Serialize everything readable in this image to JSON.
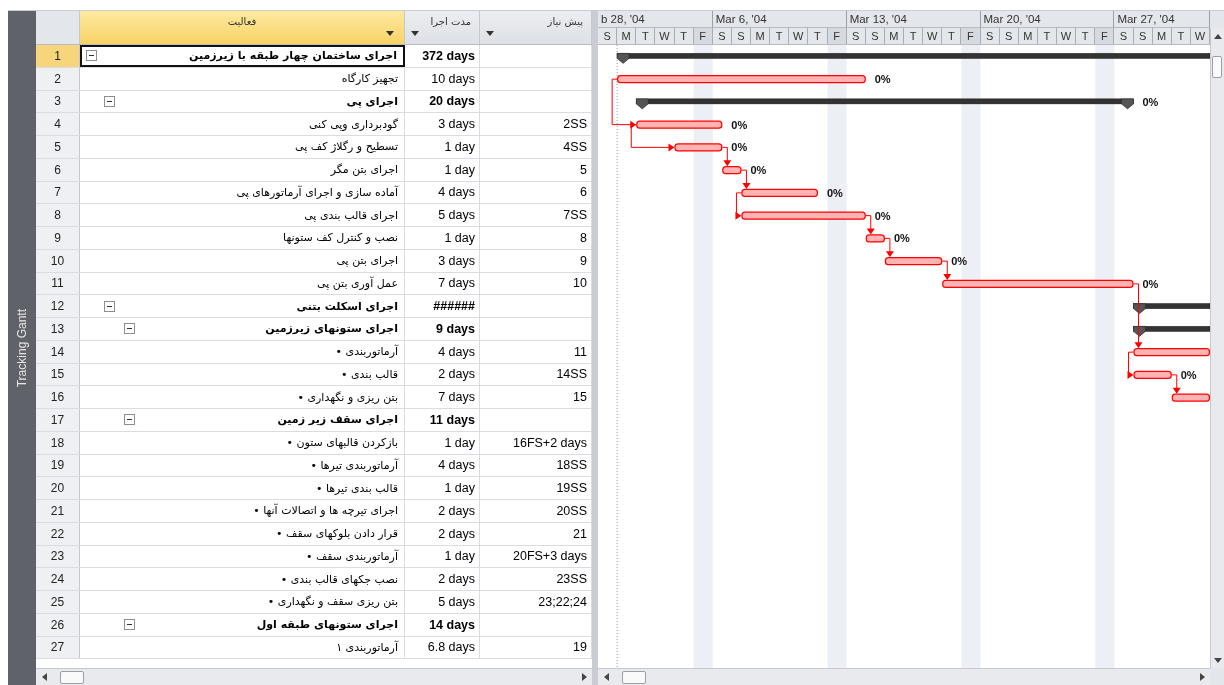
{
  "view_bar": {
    "label": "Tracking Gantt"
  },
  "table": {
    "columns": [
      {
        "label": "پیش نیاز",
        "selected": false
      },
      {
        "label": "مدت اجرا",
        "selected": false
      },
      {
        "label": "فعالیت",
        "selected": true
      }
    ],
    "rows": [
      {
        "id": "1",
        "kind": "summary",
        "expanded": true,
        "selected": true,
        "name": "اجرای ساختمان چهار طبقه با زیرزمین",
        "duration": "372 days",
        "children": [
          {
            "id": "2",
            "kind": "task",
            "selected": false,
            "name": "تجهیز کارگاه",
            "duration": "10 days"
          },
          {
            "id": "3",
            "kind": "summary",
            "expanded": true,
            "selected": false,
            "name": "اجرای پی",
            "duration": "20 days",
            "children": [
              {
                "id": "4",
                "kind": "task",
                "selected": false,
                "name": "گودبرداری وپی کنی",
                "duration": "3 days",
                "predecessors": "2SS"
              },
              {
                "id": "5",
                "kind": "task",
                "selected": false,
                "name": "تسطیح و رگلاژ کف پی",
                "duration": "1 day",
                "predecessors": "4SS"
              },
              {
                "id": "6",
                "kind": "task",
                "selected": false,
                "name": "اجرای بتن مگر",
                "duration": "1 day",
                "predecessors": "5"
              },
              {
                "id": "7",
                "kind": "task",
                "selected": false,
                "name": "آماده سازی و اجرای آرماتورهای پی",
                "duration": "4 days",
                "predecessors": "6"
              },
              {
                "id": "8",
                "kind": "task",
                "selected": false,
                "name": "اجرای قالب بندی پی",
                "duration": "5 days",
                "predecessors": "7SS"
              },
              {
                "id": "9",
                "kind": "task",
                "selected": false,
                "name": "نصب و کنترل کف ستونها",
                "duration": "1 day",
                "predecessors": "8"
              },
              {
                "id": "10",
                "kind": "task",
                "selected": false,
                "name": "اجرای بتن پی",
                "duration": "3 days",
                "predecessors": "9"
              },
              {
                "id": "11",
                "kind": "task",
                "selected": false,
                "name": "عمل آوری بتن پی",
                "duration": "7 days",
                "predecessors": "10"
              }
            ]
          },
          {
            "id": "12",
            "kind": "summary",
            "expanded": true,
            "selected": false,
            "name": "اجرای اسکلت بتنی",
            "duration": "######",
            "children": [
              {
                "id": "13",
                "kind": "summary",
                "expanded": true,
                "selected": false,
                "name": "اجرای ستونهای زیرزمین",
                "duration": "9 days",
                "children": [
                  {
                    "id": "14",
                    "kind": "task",
                    "selected": false,
                    "name": "آرماتوربندی •",
                    "duration": "4 days",
                    "predecessors": "11"
                  },
                  {
                    "id": "15",
                    "kind": "task",
                    "selected": false,
                    "name": "قالب بندی •",
                    "duration": "2 days",
                    "predecessors": "14SS"
                  },
                  {
                    "id": "16",
                    "kind": "task",
                    "selected": false,
                    "name": "بتن ریزی و نگهداری •",
                    "duration": "7 days",
                    "predecessors": "15"
                  }
                ]
              },
              {
                "id": "17",
                "kind": "summary",
                "expanded": true,
                "selected": false,
                "name": "اجرای سقف زیر زمین",
                "duration": "11 days",
                "children": [
                  {
                    "id": "18",
                    "kind": "task",
                    "selected": false,
                    "name": "بازکردن قالبهای ستون •",
                    "duration": "1 day",
                    "predecessors": "16FS+2 days"
                  },
                  {
                    "id": "19",
                    "kind": "task",
                    "selected": false,
                    "name": "آرماتوربندی تیرها •",
                    "duration": "4 days",
                    "predecessors": "18SS"
                  },
                  {
                    "id": "20",
                    "kind": "task",
                    "selected": false,
                    "name": "قالب بندی تیرها •",
                    "duration": "1 day",
                    "predecessors": "19SS"
                  },
                  {
                    "id": "21",
                    "kind": "task",
                    "selected": false,
                    "name": "اجرای تیرچه ها و اتصالات آنها •",
                    "duration": "2 days",
                    "predecessors": "20SS"
                  },
                  {
                    "id": "22",
                    "kind": "task",
                    "selected": false,
                    "name": "قرار دادن بلوکهای سقف •",
                    "duration": "2 days",
                    "predecessors": "21"
                  },
                  {
                    "id": "23",
                    "kind": "task",
                    "selected": false,
                    "name": "آرماتوربندی سقف •",
                    "duration": "1 day",
                    "predecessors": "20FS+3 days"
                  },
                  {
                    "id": "24",
                    "kind": "task",
                    "selected": false,
                    "name": "نصب جکهای قالب بندی •",
                    "duration": "2 days",
                    "predecessors": "23SS"
                  },
                  {
                    "id": "25",
                    "kind": "task",
                    "selected": false,
                    "name": "بتن ریزی سقف و نگهداری •",
                    "duration": "5 days",
                    "predecessors": "23;22;24"
                  }
                ]
              },
              {
                "id": "26",
                "kind": "summary",
                "expanded": true,
                "selected": false,
                "name": "اجرای ستونهای طبقه اول",
                "duration": "14 days",
                "children": [
                  {
                    "id": "27",
                    "kind": "task",
                    "selected": false,
                    "name": "آرماتوربندی ۱",
                    "duration": "6.8 days",
                    "predecessors": "19"
                  }
                ]
              }
            ]
          }
        ]
      }
    ]
  },
  "gantt": {
    "timescale": [
      {
        "label": "Mar 27, '04",
        "days": [
          {
            "letter": "W",
            "nonworking": false
          },
          {
            "letter": "T",
            "nonworking": false
          },
          {
            "letter": "M",
            "nonworking": false
          },
          {
            "letter": "S",
            "nonworking": false
          },
          {
            "letter": "S",
            "nonworking": false
          }
        ]
      },
      {
        "label": "Mar 20, '04",
        "days": [
          {
            "letter": "F",
            "nonworking": true
          },
          {
            "letter": "T",
            "nonworking": false
          },
          {
            "letter": "W",
            "nonworking": false
          },
          {
            "letter": "T",
            "nonworking": false
          },
          {
            "letter": "M",
            "nonworking": false
          },
          {
            "letter": "S",
            "nonworking": false
          },
          {
            "letter": "S",
            "nonworking": false
          }
        ]
      },
      {
        "label": "Mar 13, '04",
        "days": [
          {
            "letter": "F",
            "nonworking": true
          },
          {
            "letter": "T",
            "nonworking": false
          },
          {
            "letter": "W",
            "nonworking": false
          },
          {
            "letter": "T",
            "nonworking": false
          },
          {
            "letter": "M",
            "nonworking": false
          },
          {
            "letter": "S",
            "nonworking": false
          },
          {
            "letter": "S",
            "nonworking": false
          }
        ]
      },
      {
        "label": "Mar 6, '04",
        "days": [
          {
            "letter": "F",
            "nonworking": true
          },
          {
            "letter": "T",
            "nonworking": false
          },
          {
            "letter": "W",
            "nonworking": false
          },
          {
            "letter": "T",
            "nonworking": false
          },
          {
            "letter": "M",
            "nonworking": false
          },
          {
            "letter": "S",
            "nonworking": false
          },
          {
            "letter": "S",
            "nonworking": false
          }
        ]
      },
      {
        "label": "b 28, '04",
        "days": [
          {
            "letter": "F",
            "nonworking": true
          },
          {
            "letter": "T",
            "nonworking": false
          },
          {
            "letter": "W",
            "nonworking": false
          },
          {
            "letter": "T",
            "nonworking": false
          },
          {
            "letter": "M",
            "nonworking": false
          },
          {
            "letter": "S",
            "nonworking": false
          }
        ]
      }
    ],
    "bars": [
      {
        "kind": "summary"
      },
      {
        "kind": "task",
        "label": "0%"
      },
      {
        "kind": "summary",
        "label": "0%"
      },
      {
        "kind": "task",
        "label": "0%",
        "link": {
          "kind": "ss"
        }
      },
      {
        "kind": "task",
        "label": "0%",
        "link": {
          "kind": "ss"
        }
      },
      {
        "kind": "task",
        "label": "0%",
        "link": {
          "kind": "fs"
        }
      },
      {
        "kind": "task",
        "label": "0%",
        "link": {
          "kind": "fs"
        }
      },
      {
        "kind": "task",
        "label": "0%",
        "link": {
          "kind": "ss"
        }
      },
      {
        "kind": "task",
        "label": "0%",
        "link": {
          "kind": "fs"
        }
      },
      {
        "kind": "task",
        "label": "0%",
        "link": {
          "kind": "fs"
        }
      },
      {
        "kind": "task",
        "label": "0%",
        "link": {
          "kind": "fs"
        }
      },
      {
        "kind": "summary"
      },
      {
        "kind": "summary"
      },
      {
        "kind": "task",
        "link": {
          "kind": "fs"
        }
      },
      {
        "kind": "task",
        "label": "0%",
        "link": {
          "kind": "ss"
        }
      },
      {
        "kind": "task",
        "link": {
          "kind": "fs"
        }
      }
    ]
  }
}
